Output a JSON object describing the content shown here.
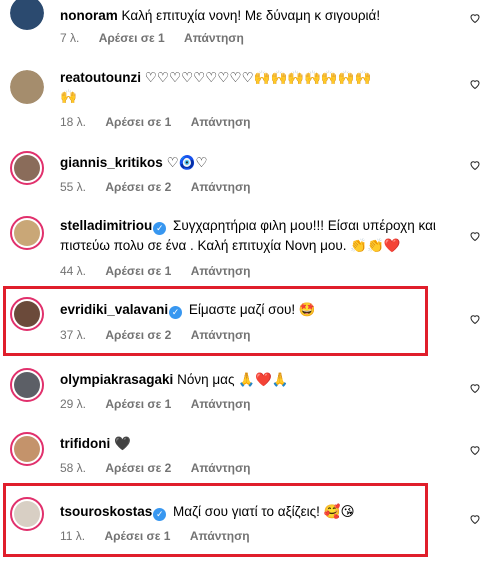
{
  "comments": [
    {
      "user": "nonoram",
      "text": "Καλή επιτυχία νονη! Με δύναμη κ σιγουριά!",
      "verified": false,
      "time": "7 λ.",
      "likes": "Αρέσει σε 1",
      "reply": "Απάντηση",
      "avatar_color": "#2b4a6f"
    },
    {
      "user": "reatoutounzi",
      "text": "♡♡♡♡♡♡♡♡♡🙌🙌🙌🙌🙌🙌🙌",
      "text2": "🙌",
      "verified": false,
      "time": "18 λ.",
      "likes": "Αρέσει σε 1",
      "reply": "Απάντηση",
      "avatar_color": "#a58d6d"
    },
    {
      "user": "giannis_kritikos",
      "text": "♡🧿♡",
      "verified": false,
      "time": "55 λ.",
      "likes": "Αρέσει σε 2",
      "reply": "Απάντηση",
      "avatar_color": "#8a6c5a"
    },
    {
      "user": "stelladimitriou",
      "text": "Συγχαρητήρια φιλη μου!!! Είσαι υπέροχη και πιστεύω πολυ σε ένα . Καλή επιτυχία Νονη μου. 👏👏❤️",
      "verified": true,
      "time": "44 λ.",
      "likes": "Αρέσει σε 1",
      "reply": "Απάντηση",
      "avatar_color": "#c9a777"
    },
    {
      "user": "evridiki_valavani",
      "text": "Είμαστε μαζί σου! 🤩",
      "verified": true,
      "time": "37 λ.",
      "likes": "Αρέσει σε 2",
      "reply": "Απάντηση",
      "avatar_color": "#6b4a3a"
    },
    {
      "user": "olympiakrasagaki",
      "text": "Νόνη μας 🙏❤️🙏",
      "verified": false,
      "time": "29 λ.",
      "likes": "Αρέσει σε 1",
      "reply": "Απάντηση",
      "avatar_color": "#5c5f66"
    },
    {
      "user": "trifidoni",
      "text": "🖤",
      "verified": false,
      "time": "58 λ.",
      "likes": "Αρέσει σε 2",
      "reply": "Απάντηση",
      "avatar_color": "#c4936b"
    },
    {
      "user": "tsouroskostas",
      "text": "Μαζί σου γιατί το αξίζεις! 🥰😘",
      "verified": true,
      "time": "11 λ.",
      "likes": "Αρέσει σε 1",
      "reply": "Απάντηση",
      "avatar_color": "#d8cfc4"
    }
  ],
  "colors": {
    "highlight": "#e01e2b",
    "verified": "#3897f0",
    "meta": "#737373",
    "story_ring": "#e1306c"
  }
}
